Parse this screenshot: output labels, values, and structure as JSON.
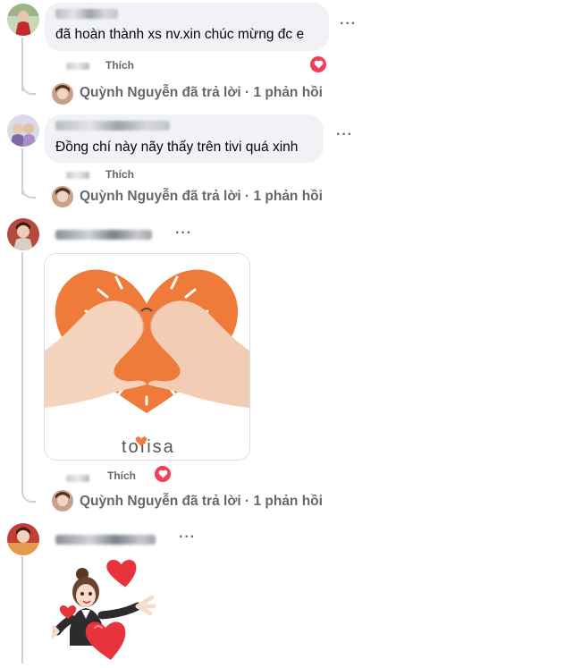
{
  "comments": [
    {
      "text": "đã hoàn thành xs nv.xin chúc mừng đc e",
      "like_label": "Thích",
      "reply_summary": "Quỳnh Nguyễn đã trả lời · 1 phản hồi"
    },
    {
      "text": "Đồng chí này nãy thấy trên tivi quá xinh",
      "like_label": "Thích",
      "reply_summary": "Quỳnh Nguyễn đã trả lời · 1 phản hồi"
    },
    {
      "image_brand": "tofisa",
      "like_label": "Thích",
      "reply_summary": "Quỳnh Nguyễn đã trả lời · 1 phản hồi"
    },
    {
      "sticker": "3d-girl-with-hearts"
    }
  ],
  "icons": {
    "more": "more-options-icon",
    "reaction": "heart-reaction-icon"
  },
  "colors": {
    "bubble": "#f0f2f5",
    "secondary_text": "#65676b",
    "heart": "#f33e58",
    "heart_card_orange": "#f07a3a"
  }
}
